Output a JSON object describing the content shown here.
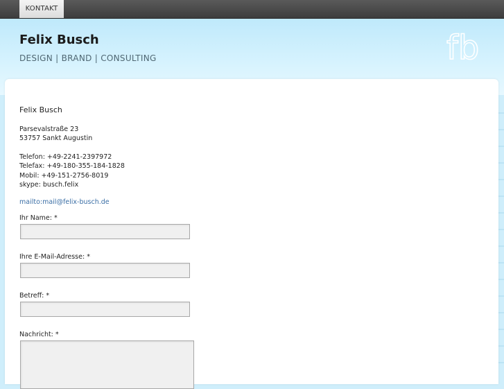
{
  "nav": {
    "tabs": [
      {
        "label": "KONTAKT"
      }
    ]
  },
  "header": {
    "title": "Felix Busch",
    "tagline": "DESIGN | BRAND | CONSULTING",
    "logo_text": "fb"
  },
  "contact": {
    "name": "Felix Busch",
    "address": [
      "Parsevalstraße 23",
      "53757 Sankt Augustin"
    ],
    "phones": [
      "Telefon: +49-2241-2397972",
      "Telefax: +49-180-355-184-1828",
      "Mobil: +49-151-2756-8019",
      "skype: busch.felix"
    ],
    "mail_link": "mailto:mail@felix-busch.de"
  },
  "form": {
    "name_label": "Ihr Name: *",
    "email_label": "Ihre E-Mail-Adresse: *",
    "subject_label": "Betreff: *",
    "message_label": "Nachricht: *"
  }
}
